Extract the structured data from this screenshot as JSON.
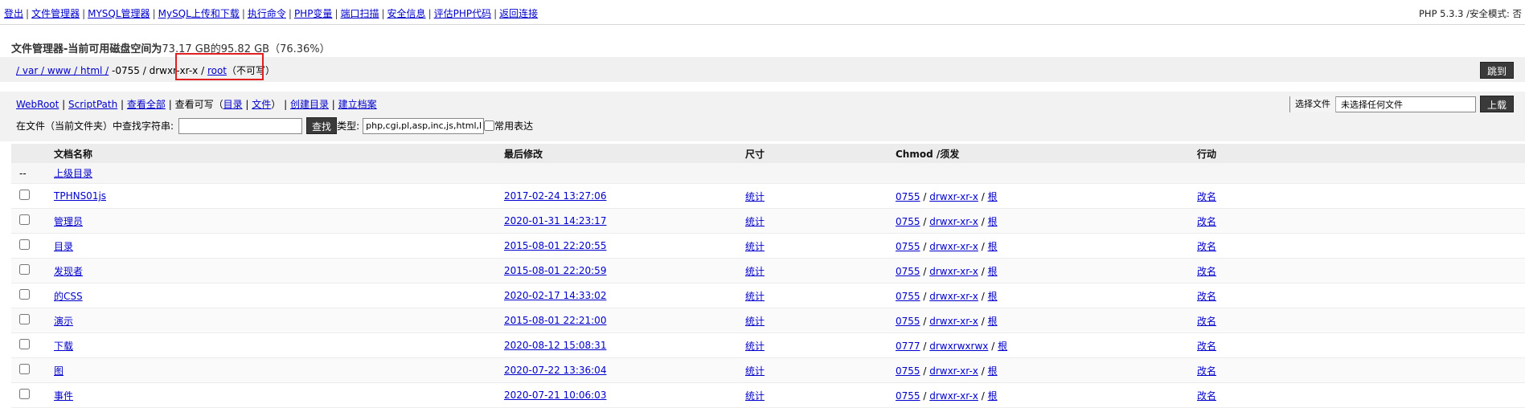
{
  "nav": {
    "items": [
      "登出",
      "文件管理器",
      "MYSQL管理器",
      "MySQL上传和下载",
      "执行命令",
      "PHP变量",
      "端口扫描",
      "安全信息",
      "评估PHP代码",
      "返回连接"
    ],
    "php_info": "PHP 5.3.3 /安全模式: 否"
  },
  "title": {
    "prefix": "文件管理器-当前可用磁盘空间为",
    "value": "73.17 GB的95.82 GB（76.36%）"
  },
  "path": {
    "link": "/ var / www / html /",
    "perm_text": " -0755 / drwxr-xr-x / ",
    "root_link": "root",
    "status": "（不可写）"
  },
  "jump_label": "跳到",
  "toolbar": {
    "webroot": "WebRoot",
    "scriptpath": "ScriptPath",
    "view_all": "查看全部",
    "view_writable": "查看可写（",
    "dir": "目录",
    "file": "文件",
    "close_paren": "）",
    "create_dir": "创建目录",
    "create_file": "建立档案",
    "search_label": "在文件（当前文件夹）中查找字符串:",
    "search_value": "",
    "find_label": "查找",
    "type_label": "类型:",
    "type_value": "php,cgi,pl,asp,inc,js,html,htm",
    "regex_label": "常用表达"
  },
  "upload": {
    "choose": "选择文件",
    "no_file": "未选择任何文件",
    "button": "上载"
  },
  "table": {
    "headers": [
      "文档名称",
      "最后修改",
      "尺寸",
      "Chmod /须发",
      "行动"
    ],
    "parent": {
      "dash": "--",
      "label": "上级目录"
    },
    "rows": [
      {
        "name": "TPHNS01js",
        "modified": "2017-02-24 13:27:06",
        "size": "统计",
        "chmod": "0755",
        "perm": "drwxr-xr-x",
        "owner": "根",
        "action": "改名"
      },
      {
        "name": "管理员",
        "modified": "2020-01-31 14:23:17",
        "size": "统计",
        "chmod": "0755",
        "perm": "drwxr-xr-x",
        "owner": "根",
        "action": "改名"
      },
      {
        "name": "目录",
        "modified": "2015-08-01 22:20:55",
        "size": "统计",
        "chmod": "0755",
        "perm": "drwxr-xr-x",
        "owner": "根",
        "action": "改名"
      },
      {
        "name": "发现者",
        "modified": "2015-08-01 22:20:59",
        "size": "统计",
        "chmod": "0755",
        "perm": "drwxr-xr-x",
        "owner": "根",
        "action": "改名"
      },
      {
        "name": "的CSS",
        "modified": "2020-02-17 14:33:02",
        "size": "统计",
        "chmod": "0755",
        "perm": "drwxr-xr-x",
        "owner": "根",
        "action": "改名"
      },
      {
        "name": "演示",
        "modified": "2015-08-01 22:21:00",
        "size": "统计",
        "chmod": "0755",
        "perm": "drwxr-xr-x",
        "owner": "根",
        "action": "改名"
      },
      {
        "name": "下载",
        "modified": "2020-08-12 15:08:31",
        "size": "统计",
        "chmod": "0777",
        "perm": "drwxrwxrwx",
        "owner": "根",
        "action": "改名"
      },
      {
        "name": "图",
        "modified": "2020-07-22 13:36:04",
        "size": "统计",
        "chmod": "0755",
        "perm": "drwxr-xr-x",
        "owner": "根",
        "action": "改名"
      },
      {
        "name": "事件",
        "modified": "2020-07-21 10:06:03",
        "size": "统计",
        "chmod": "0755",
        "perm": "drwxr-xr-x",
        "owner": "根",
        "action": "改名"
      }
    ]
  }
}
